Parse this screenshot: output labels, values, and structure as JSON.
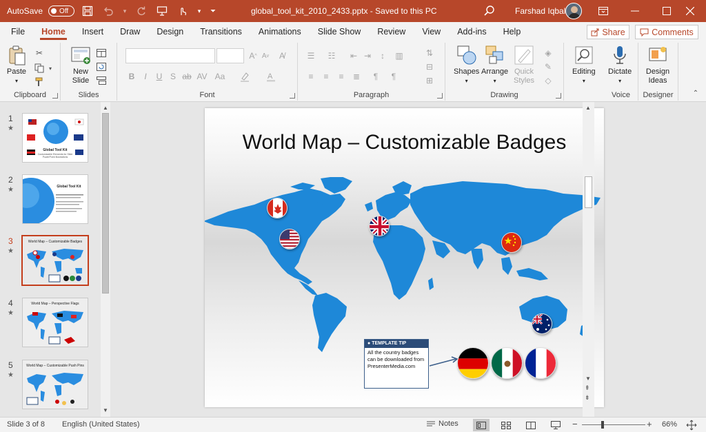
{
  "titlebar": {
    "autosave_label": "AutoSave",
    "autosave_state": "Off",
    "doc_title": "global_tool_kit_2010_2433.pptx  -  Saved to this PC",
    "user_name": "Farshad Iqbal"
  },
  "tabs": [
    "File",
    "Home",
    "Insert",
    "Draw",
    "Design",
    "Transitions",
    "Animations",
    "Slide Show",
    "Review",
    "View",
    "Add-ins",
    "Help"
  ],
  "active_tab": "Home",
  "share_label": "Share",
  "comments_label": "Comments",
  "ribbon": {
    "clipboard": {
      "paste": "Paste",
      "label": "Clipboard"
    },
    "slides": {
      "new_slide": "New Slide",
      "label": "Slides"
    },
    "font": {
      "label": "Font",
      "bold": "B",
      "italic": "I",
      "underline": "U",
      "strike": "S",
      "shadow": "ab"
    },
    "paragraph": {
      "label": "Paragraph"
    },
    "drawing": {
      "shapes": "Shapes",
      "arrange": "Arrange",
      "quick_styles": "Quick Styles",
      "label": "Drawing"
    },
    "editing": {
      "label": "Editing"
    },
    "voice": {
      "dictate": "Dictate",
      "label": "Voice"
    },
    "designer": {
      "design_ideas": "Design Ideas",
      "label": "Designer"
    }
  },
  "thumbnails": [
    {
      "num": "1",
      "star": "★",
      "title": "Global Tool Kit",
      "sub": "Customizable Elements for Slide PowerPoint Illustrations"
    },
    {
      "num": "2",
      "star": "★",
      "title": "Global Tool Kit",
      "sub": ""
    },
    {
      "num": "3",
      "star": "★",
      "title": "World Map – Customizable Badges",
      "sub": ""
    },
    {
      "num": "4",
      "star": "★",
      "title": "World Map – Perspective Flags",
      "sub": ""
    },
    {
      "num": "5",
      "star": "★",
      "title": "World Map – Customizable Push Pins",
      "sub": ""
    }
  ],
  "slide": {
    "title": "World Map – Customizable Badges",
    "tip_head": "TEMPLATE TIP",
    "tip_body": "All the country badges can be downloaded from PresenterMedia.com"
  },
  "statusbar": {
    "slide_info": "Slide 3 of 8",
    "language": "English (United States)",
    "notes": "Notes",
    "zoom": "66%"
  },
  "colors": {
    "accent": "#b7472a",
    "map_blue": "#1e88d8",
    "tip_blue": "#2c4c78"
  }
}
